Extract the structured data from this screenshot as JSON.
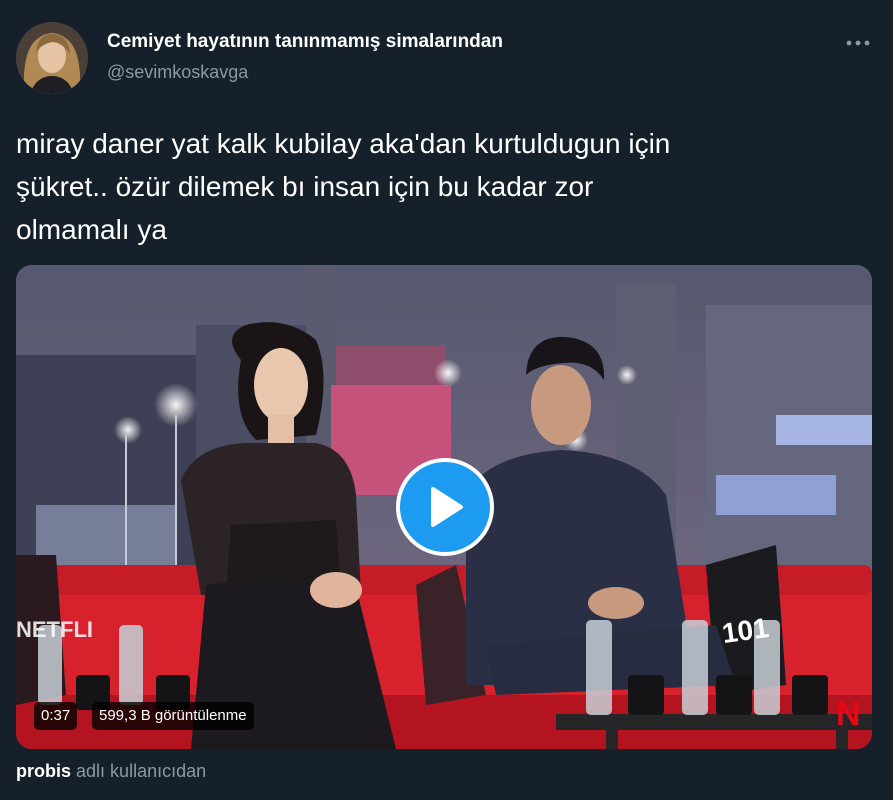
{
  "author": {
    "display_name": "Cemiyet hayatının tanınmamış simalarından",
    "handle": "@sevimkoskavga",
    "avatar": "profile-photo"
  },
  "more_icon": "more-dots-icon",
  "tweet": {
    "line1": "miray daner yat kalk kubilay aka'dan kurtuldugun için",
    "line2": "şükret.. özür dilemek bı insan için bu kadar zor",
    "line3": "olmamalı ya"
  },
  "media": {
    "play_icon": "play-icon",
    "duration": "0:37",
    "views": "599,3 B görüntülenme",
    "cushion_text": "101",
    "sofa_text": "NETFLI",
    "watermark": "N"
  },
  "attribution": {
    "user": "probis",
    "suffix": "adlı kullanıcıdan"
  },
  "colors": {
    "background": "#15202b",
    "accent": "#1d9bf0",
    "secondary_text": "#8b98a5",
    "netflix_red": "#e50914"
  }
}
